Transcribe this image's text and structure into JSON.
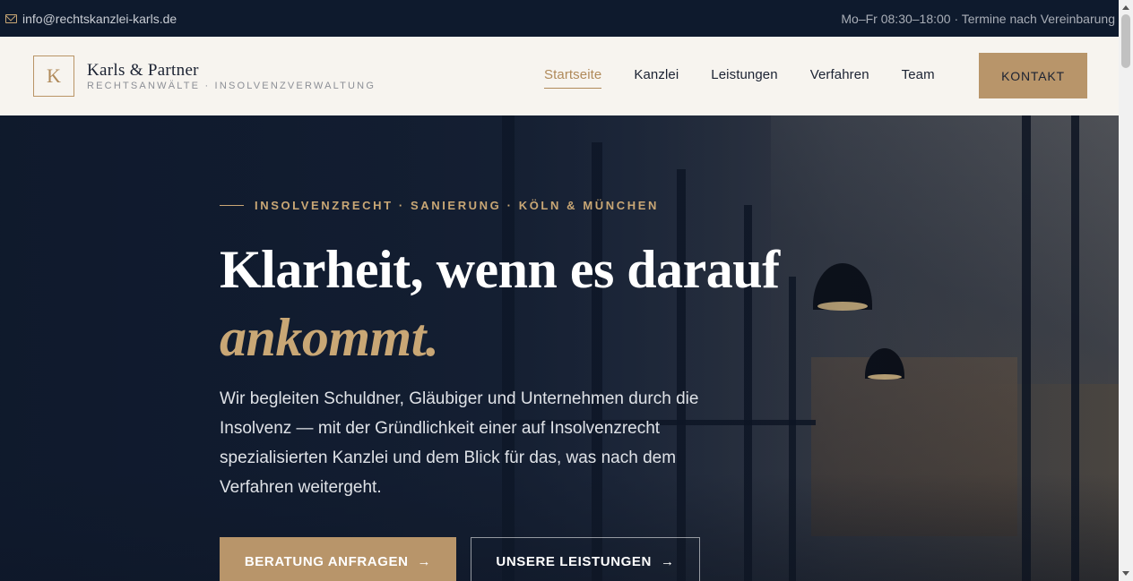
{
  "topbar": {
    "email": "info@rechtskanzlei-karls.de",
    "hours": "Mo–Fr 08:30–18:00 · Termine nach Vereinbarung"
  },
  "header": {
    "logo_letter": "K",
    "firm_name": "Karls & Partner",
    "tagline": "RECHTSANWÄLTE · INSOLVENZVERWALTUNG",
    "nav": [
      {
        "label": "Startseite",
        "active": true
      },
      {
        "label": "Kanzlei",
        "active": false
      },
      {
        "label": "Leistungen",
        "active": false
      },
      {
        "label": "Verfahren",
        "active": false
      },
      {
        "label": "Team",
        "active": false
      }
    ],
    "contact_label": "KONTAKT"
  },
  "hero": {
    "eyebrow": "INSOLVENZRECHT · SANIERUNG · KÖLN & MÜNCHEN",
    "headline_main": "Klarheit, wenn es darauf",
    "headline_accent": "ankommt.",
    "lead": "Wir begleiten Schuldner, Gläubiger und Unternehmen durch die Insolvenz — mit der Gründlichkeit einer auf Insolvenzrecht spezialisierten Kanzlei und dem Blick für das, was nach dem Verfahren weitergeht.",
    "primary_cta": "BERATUNG ANFRAGEN",
    "secondary_cta": "UNSERE LEISTUNGEN",
    "arrow": "→"
  },
  "colors": {
    "accent": "#b8956a",
    "dark": "#0e1a2d",
    "header_bg": "#f7f4ef"
  }
}
